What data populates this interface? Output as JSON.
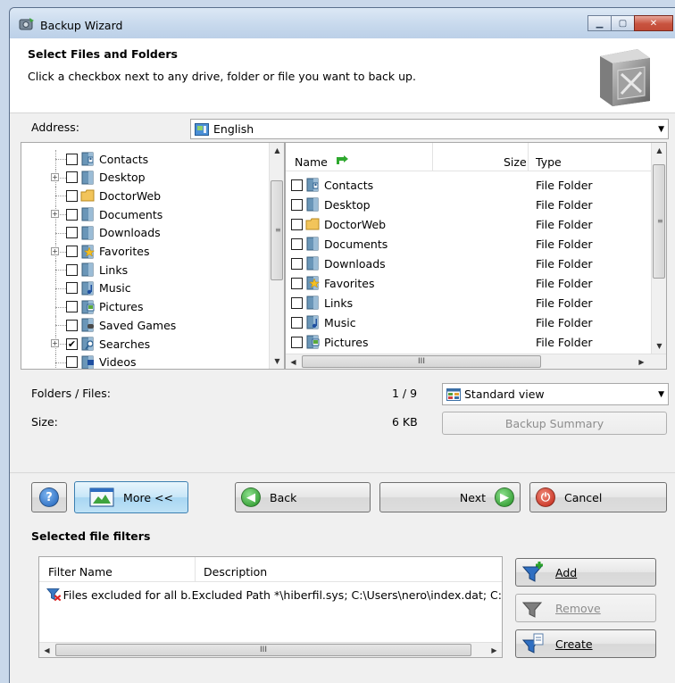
{
  "window": {
    "title": "Backup Wizard",
    "icon": "backup-wizard-icon"
  },
  "header": {
    "heading": "Select Files and Folders",
    "instructions": "Click a checkbox next to any drive, folder or file you want to back up."
  },
  "address": {
    "label": "Address:",
    "value": "English"
  },
  "tree": {
    "items": [
      {
        "label": "Contacts",
        "checked": false,
        "expander": false,
        "icon": "contacts-folder-icon"
      },
      {
        "label": "Desktop",
        "checked": false,
        "expander": true,
        "icon": "desktop-folder-icon"
      },
      {
        "label": "DoctorWeb",
        "checked": false,
        "expander": false,
        "icon": "folder-icon"
      },
      {
        "label": "Documents",
        "checked": false,
        "expander": true,
        "icon": "documents-folder-icon"
      },
      {
        "label": "Downloads",
        "checked": false,
        "expander": false,
        "icon": "downloads-folder-icon"
      },
      {
        "label": "Favorites",
        "checked": false,
        "expander": true,
        "icon": "favorites-folder-icon"
      },
      {
        "label": "Links",
        "checked": false,
        "expander": false,
        "icon": "links-folder-icon"
      },
      {
        "label": "Music",
        "checked": false,
        "expander": false,
        "icon": "music-folder-icon"
      },
      {
        "label": "Pictures",
        "checked": false,
        "expander": false,
        "icon": "pictures-folder-icon"
      },
      {
        "label": "Saved Games",
        "checked": false,
        "expander": false,
        "icon": "saved-games-folder-icon"
      },
      {
        "label": "Searches",
        "checked": true,
        "expander": true,
        "icon": "searches-folder-icon"
      },
      {
        "label": "Videos",
        "checked": false,
        "expander": false,
        "icon": "videos-folder-icon"
      }
    ]
  },
  "filelist": {
    "columns": {
      "name": "Name",
      "size": "Size",
      "type": "Type"
    },
    "rows": [
      {
        "name": "Contacts",
        "type": "File Folder"
      },
      {
        "name": "Desktop",
        "type": "File Folder"
      },
      {
        "name": "DoctorWeb",
        "type": "File Folder"
      },
      {
        "name": "Documents",
        "type": "File Folder"
      },
      {
        "name": "Downloads",
        "type": "File Folder"
      },
      {
        "name": "Favorites",
        "type": "File Folder"
      },
      {
        "name": "Links",
        "type": "File Folder"
      },
      {
        "name": "Music",
        "type": "File Folder"
      },
      {
        "name": "Pictures",
        "type": "File Folder"
      }
    ],
    "hscroll_grip": "III"
  },
  "stats": {
    "folders_files_label": "Folders / Files:",
    "folders_files_value": "1 / 9",
    "size_label": "Size:",
    "size_value": "6 KB",
    "view_value": "Standard view",
    "summary_button": "Backup Summary"
  },
  "nav": {
    "help_glyph": "?",
    "more_label": "More <<",
    "back_label": "Back",
    "next_label": "Next",
    "cancel_label": "Cancel"
  },
  "filters": {
    "section_title": "Selected file filters",
    "columns": {
      "name": "Filter Name",
      "description": "Description"
    },
    "rows": [
      {
        "name": "Files excluded for all b...",
        "description": "Excluded Path *\\hiberfil.sys; C:\\Users\\nero\\index.dat; C:"
      }
    ],
    "hscroll_grip": "III",
    "add_label": "Add",
    "remove_label": "Remove",
    "create_label": "Create"
  }
}
